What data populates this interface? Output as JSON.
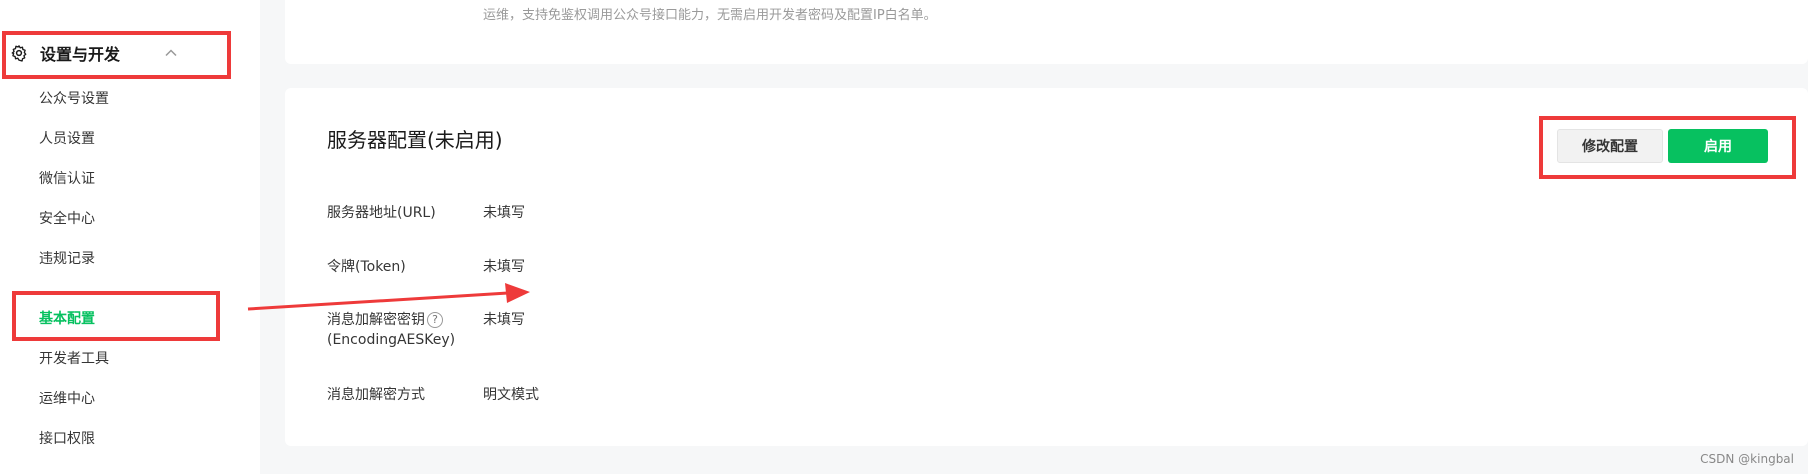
{
  "sidebar": {
    "group_label": "设置与开发",
    "items": [
      {
        "label": "公众号设置"
      },
      {
        "label": "人员设置"
      },
      {
        "label": "微信认证"
      },
      {
        "label": "安全中心"
      },
      {
        "label": "违规记录"
      },
      {
        "label": "基本配置",
        "active": true
      },
      {
        "label": "开发者工具"
      },
      {
        "label": "运维中心"
      },
      {
        "label": "接口权限"
      }
    ]
  },
  "top_card": {
    "text": "运维，支持免鉴权调用公众号接口能力，无需启用开发者密码及配置IP白名单。"
  },
  "server_config": {
    "title": "服务器配置(未启用)",
    "edit_button": "修改配置",
    "enable_button": "启用",
    "fields": [
      {
        "label": "服务器地址(URL)",
        "value": "未填写"
      },
      {
        "label": "令牌(Token)",
        "value": "未填写"
      },
      {
        "label_line1": "消息加解密密钥",
        "label_line2": "(EncodingAESKey)",
        "help": "?",
        "value": "未填写"
      },
      {
        "label": "消息加解密方式",
        "value": "明文模式"
      }
    ]
  },
  "icons": {
    "gear": "gear-icon",
    "chevron": "chevron-up-icon",
    "help": "help-circle-icon"
  },
  "colors": {
    "accent": "#07c160",
    "annotation": "#ee3a3a"
  },
  "watermark": "CSDN @kingbal"
}
